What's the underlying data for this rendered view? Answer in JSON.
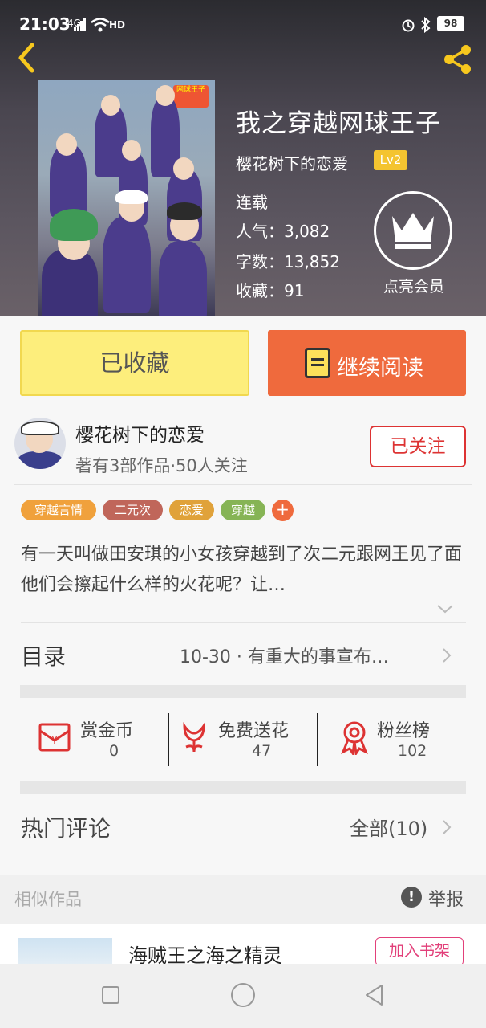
{
  "status_bar": {
    "time": "21:03",
    "network": "4G",
    "hd": "HD",
    "battery": "98"
  },
  "book": {
    "title": "我之穿越网球王子",
    "author": "樱花树下的恋爱",
    "level": "Lv2",
    "status": "连载",
    "popularity": "人气：3,082",
    "word_count": "字数：13,852",
    "favorites": "收藏：91",
    "vip_label": "点亮会员"
  },
  "actions": {
    "collect_label": "已收藏",
    "read_label": "继续阅读"
  },
  "author_row": {
    "name": "樱花树下的恋爱",
    "stats": "著有3部作品·50人关注",
    "follow_label": "已关注"
  },
  "tags": [
    {
      "label": "穿越言情",
      "color": "#f0a13c"
    },
    {
      "label": "二元次",
      "color": "#c0665a"
    },
    {
      "label": "恋爱",
      "color": "#e0a23a"
    },
    {
      "label": "穿越",
      "color": "#86b455"
    }
  ],
  "tag_add": "+",
  "description": "有一天叫做田安琪的小女孩穿越到了次二元跟网王见了面他们会擦起什么样的火花呢？让…",
  "toc": {
    "label": "目录",
    "latest": "10-30 · 有重大的事宣布…"
  },
  "stats": [
    {
      "label": "赏金币",
      "value": "0",
      "icon": "coin-envelope-icon"
    },
    {
      "label": "免费送花",
      "value": "47",
      "icon": "flower-icon"
    },
    {
      "label": "粉丝榜",
      "value": "102",
      "icon": "medal-icon"
    }
  ],
  "comments": {
    "label": "热门评论",
    "all_label": "全部(10)"
  },
  "similar": {
    "label": "相似作品",
    "report_label": "举报"
  },
  "recommendation": {
    "title": "海贼王之海之精灵",
    "add_label": "加入书架"
  },
  "cover_badge": "网球王子",
  "colors": {
    "accent_orange": "#ef6a3d",
    "collect_yellow": "#fdee7c",
    "follow_red": "#d33",
    "share_yellow": "#f7c81e"
  }
}
